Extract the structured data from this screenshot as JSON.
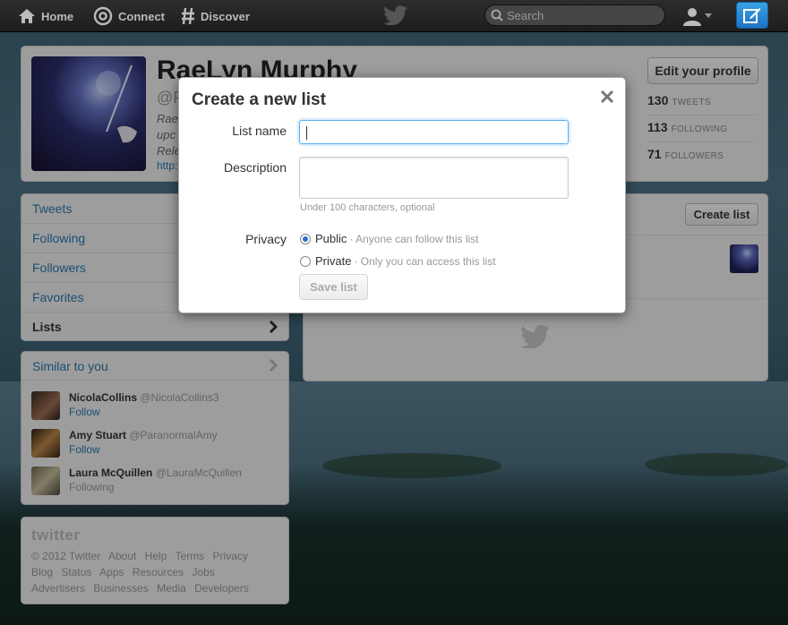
{
  "topbar": {
    "home_label": "Home",
    "connect_label": "Connect",
    "discover_label": "Discover",
    "search_placeholder": "Search"
  },
  "profile": {
    "name": "RaeLyn Murphy",
    "handle": "@F",
    "bio_lines": [
      "Rae",
      "upc",
      "Rele"
    ],
    "url": "http:",
    "edit_label": "Edit your profile",
    "stats": [
      {
        "count": "130",
        "label": "TWEETS"
      },
      {
        "count": "113",
        "label": "FOLLOWING"
      },
      {
        "count": "71",
        "label": "FOLLOWERS"
      }
    ]
  },
  "nav": {
    "items": [
      {
        "label": "Tweets"
      },
      {
        "label": "Following"
      },
      {
        "label": "Followers"
      },
      {
        "label": "Favorites"
      },
      {
        "label": "Lists"
      }
    ]
  },
  "similar": {
    "heading": "Similar to you",
    "people": [
      {
        "name": "NicolaCollins",
        "handle": "@NicolaCollins3",
        "action": "Follow"
      },
      {
        "name": "Amy Stuart",
        "handle": "@ParanormalAmy",
        "action": "Follow"
      },
      {
        "name": "Laura McQuillen",
        "handle": "@LauraMcQuillen",
        "action": "Following"
      }
    ]
  },
  "footer": {
    "logo": "twitter",
    "line1": [
      "© 2012 Twitter",
      "About",
      "Help",
      "Terms",
      "Privacy"
    ],
    "line2": [
      "Blog",
      "Status",
      "Apps",
      "Resources",
      "Jobs"
    ],
    "line3": [
      "Advertisers",
      "Businesses",
      "Media",
      "Developers"
    ]
  },
  "lists": {
    "create_label": "Create list"
  },
  "modal": {
    "title": "Create a new list",
    "list_name_label": "List name",
    "list_name_value": "",
    "description_label": "Description",
    "description_hint": "Under 100 characters, optional",
    "privacy_label": "Privacy",
    "public_label": "Public",
    "public_desc": "· Anyone can follow this list",
    "private_label": "Private",
    "private_desc": "· Only you can access this list",
    "save_label": "Save list"
  },
  "colors": {
    "accent": "#2a7ab0",
    "compose_blue": "#1f72c4"
  }
}
